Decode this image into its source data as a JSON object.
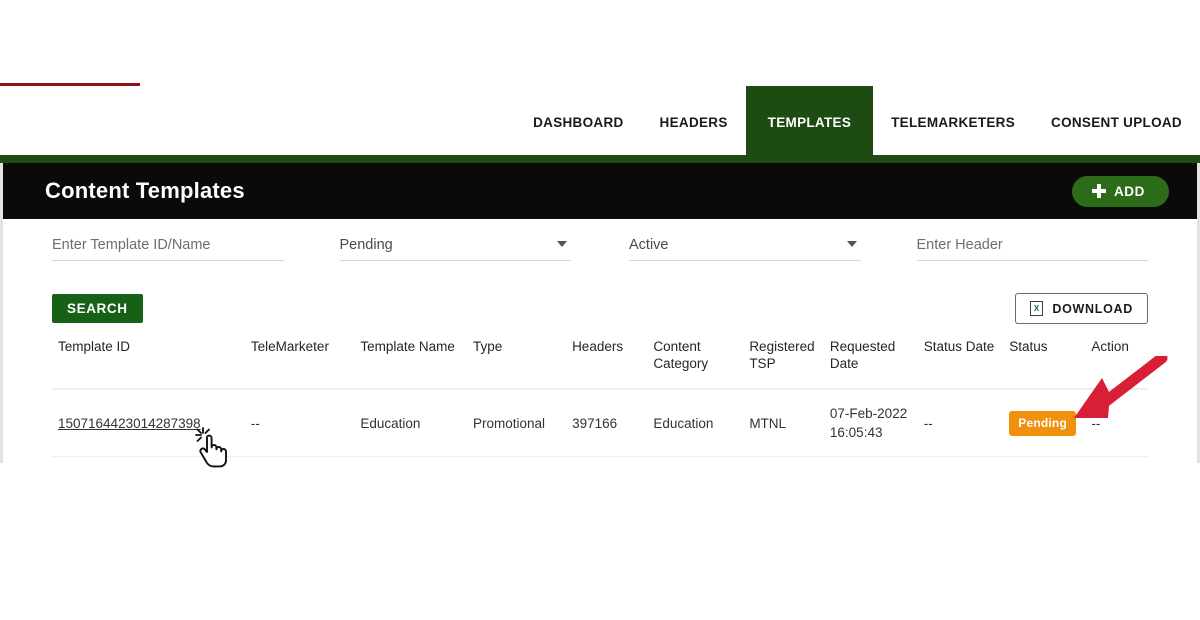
{
  "nav": {
    "items": [
      {
        "label": "DASHBOARD",
        "active": false
      },
      {
        "label": "HEADERS",
        "active": false
      },
      {
        "label": "TEMPLATES",
        "active": true
      },
      {
        "label": "TELEMARKETERS",
        "active": false
      },
      {
        "label": "CONSENT UPLOAD",
        "active": false
      }
    ],
    "active_bg": "#1d4b12"
  },
  "titlebar": {
    "title": "Content Templates",
    "add_label": "ADD",
    "background": "#0a0a0a",
    "add_bg": "#2c6b17"
  },
  "filters": {
    "template_id": {
      "value": "",
      "placeholder": "Enter Template ID/Name"
    },
    "status": {
      "value": "Pending"
    },
    "active": {
      "value": "Active"
    },
    "header": {
      "value": "",
      "placeholder": "Enter Header"
    }
  },
  "actions": {
    "search_label": "SEARCH",
    "search_bg": "#176117",
    "download_label": "DOWNLOAD",
    "download_icon": "spreadsheet-icon",
    "download_icon_glyph": "X"
  },
  "table": {
    "columns": [
      "Template ID",
      "TeleMarketer",
      "Template Name",
      "Type",
      "Headers",
      "Content Category",
      "Registered TSP",
      "Requested Date",
      "Status Date",
      "Status",
      "Action"
    ],
    "rows": [
      {
        "template_id": "1507164423014287398",
        "telemarketer": "--",
        "template_name": "Education",
        "type": "Promotional",
        "headers": "397166",
        "content_category": "Education",
        "registered_tsp": "MTNL",
        "requested_date_line1": "07-Feb-2022",
        "requested_date_line2": "16:05:43",
        "status_date": "--",
        "status": "Pending",
        "status_color": "#f0900d",
        "action": "--"
      }
    ]
  },
  "annotations": {
    "arrow": {
      "name": "red-arrow-annotation",
      "color": "#d81f36",
      "points_to": "Action column"
    },
    "cursor": {
      "name": "click-cursor",
      "over": "Template ID link"
    }
  }
}
